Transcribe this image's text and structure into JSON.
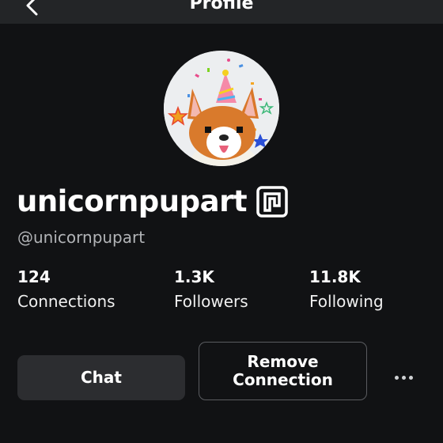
{
  "header": {
    "title": "Profile",
    "back_icon": "chevron-left-icon"
  },
  "profile": {
    "avatar_icon": "avatar-corgi-party-icon",
    "display_name": "unicornpupart",
    "badge_icon": "premium-badge-icon",
    "handle": "@unicornpupart"
  },
  "stats": [
    {
      "count": "124",
      "label": "Connections"
    },
    {
      "count": "1.3K",
      "label": "Followers"
    },
    {
      "count": "11.8K",
      "label": "Following"
    }
  ],
  "actions": {
    "chat_label": "Chat",
    "remove_label": "Remove Connection",
    "more_icon": "more-horizontal-icon"
  },
  "colors": {
    "background": "#111214",
    "header": "#232527",
    "secondary_text": "#b2b4b7",
    "chat_button": "#2c2d30",
    "outline_button_border": "#5a5c60"
  }
}
